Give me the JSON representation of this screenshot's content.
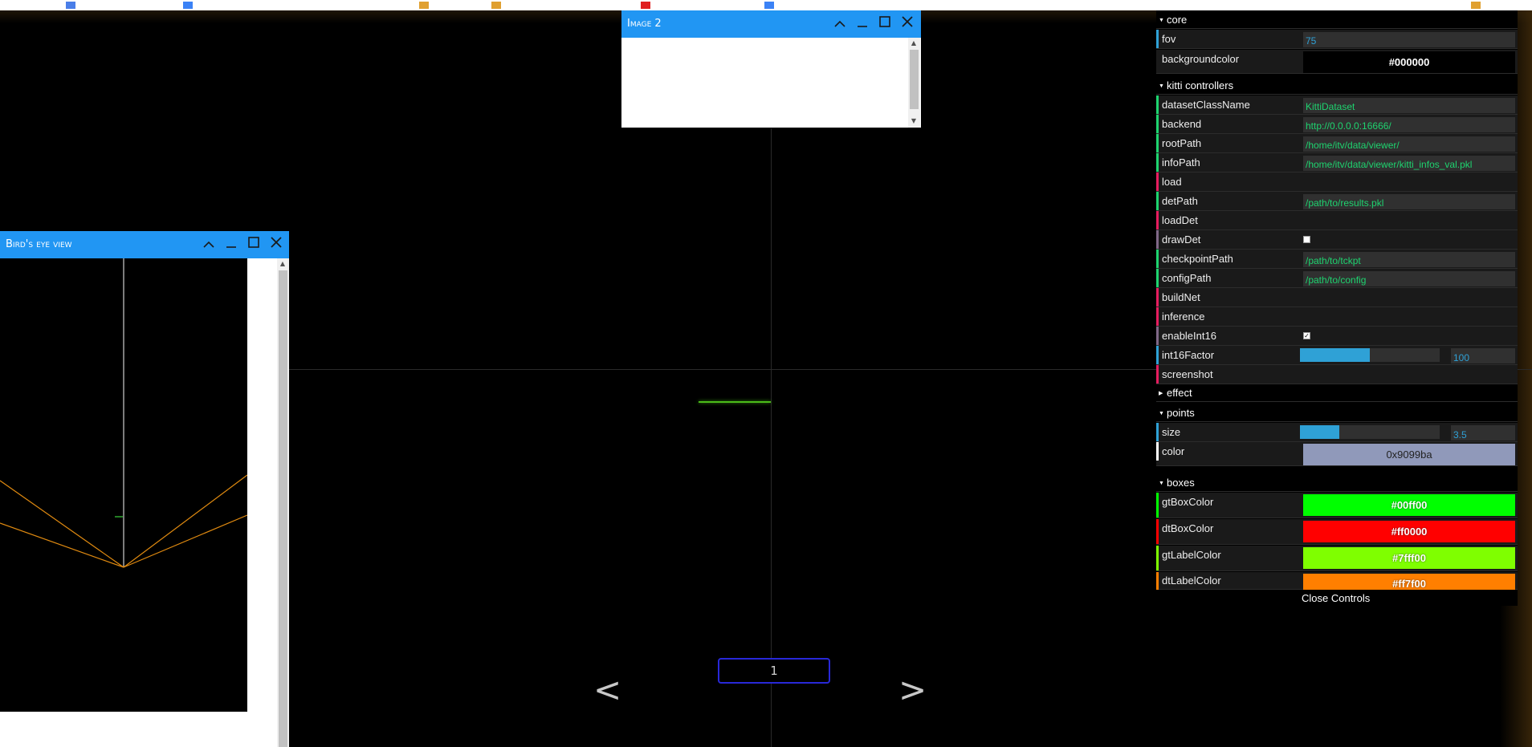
{
  "viewer": {
    "page_number": "1",
    "prev_label": "<",
    "next_label": ">"
  },
  "image2_window": {
    "title": "Image 2"
  },
  "bev_window": {
    "title": "Bird's eye view"
  },
  "window_controls": {
    "collapse": "^",
    "minimize": "_",
    "maximize": "□",
    "close": "✕"
  },
  "controls": {
    "core": {
      "label": "core",
      "fov": {
        "label": "fov",
        "value": "75"
      },
      "backgroundcolor": {
        "label": "backgroundcolor",
        "value": "#000000"
      }
    },
    "kitti": {
      "label": "kitti controllers",
      "datasetClassName": {
        "label": "datasetClassName",
        "value": "KittiDataset"
      },
      "backend": {
        "label": "backend",
        "value": "http://0.0.0.0:16666/"
      },
      "rootPath": {
        "label": "rootPath",
        "value": "/home/itv/data/viewer/"
      },
      "infoPath": {
        "label": "infoPath",
        "value": "/home/itv/data/viewer/kitti_infos_val.pkl"
      },
      "load": {
        "label": "load"
      },
      "detPath": {
        "label": "detPath",
        "value": "/path/to/results.pkl"
      },
      "loadDet": {
        "label": "loadDet"
      },
      "drawDet": {
        "label": "drawDet",
        "checked": false
      },
      "checkpointPath": {
        "label": "checkpointPath",
        "value": "/path/to/tckpt"
      },
      "configPath": {
        "label": "configPath",
        "value": "/path/to/config"
      },
      "buildNet": {
        "label": "buildNet"
      },
      "inference": {
        "label": "inference"
      },
      "enableInt16": {
        "label": "enableInt16",
        "checked": true
      },
      "int16Factor": {
        "label": "int16Factor",
        "value": "100",
        "fraction": 0.5
      },
      "screenshot": {
        "label": "screenshot"
      }
    },
    "effect": {
      "label": "effect"
    },
    "points": {
      "label": "points",
      "size": {
        "label": "size",
        "value": "3.5",
        "fraction": 0.28
      },
      "color": {
        "label": "color",
        "value": "0x9099ba"
      }
    },
    "boxes": {
      "label": "boxes",
      "gtBoxColor": {
        "label": "gtBoxColor",
        "value": "#00ff00"
      },
      "dtBoxColor": {
        "label": "dtBoxColor",
        "value": "#ff0000"
      },
      "gtLabelColor": {
        "label": "gtLabelColor",
        "value": "#7fff00"
      },
      "dtLabelColor": {
        "label": "dtLabelColor",
        "value": "#ff7f00"
      }
    },
    "close_label": "Close Controls"
  },
  "colors": {
    "accent": "#2196f3",
    "number": "#2fa1d6",
    "string": "#1ed36f",
    "function": "#e61d5f",
    "boolean": "#806787",
    "color_bar": "#2fa1d6",
    "points_color": "#9099ba"
  }
}
